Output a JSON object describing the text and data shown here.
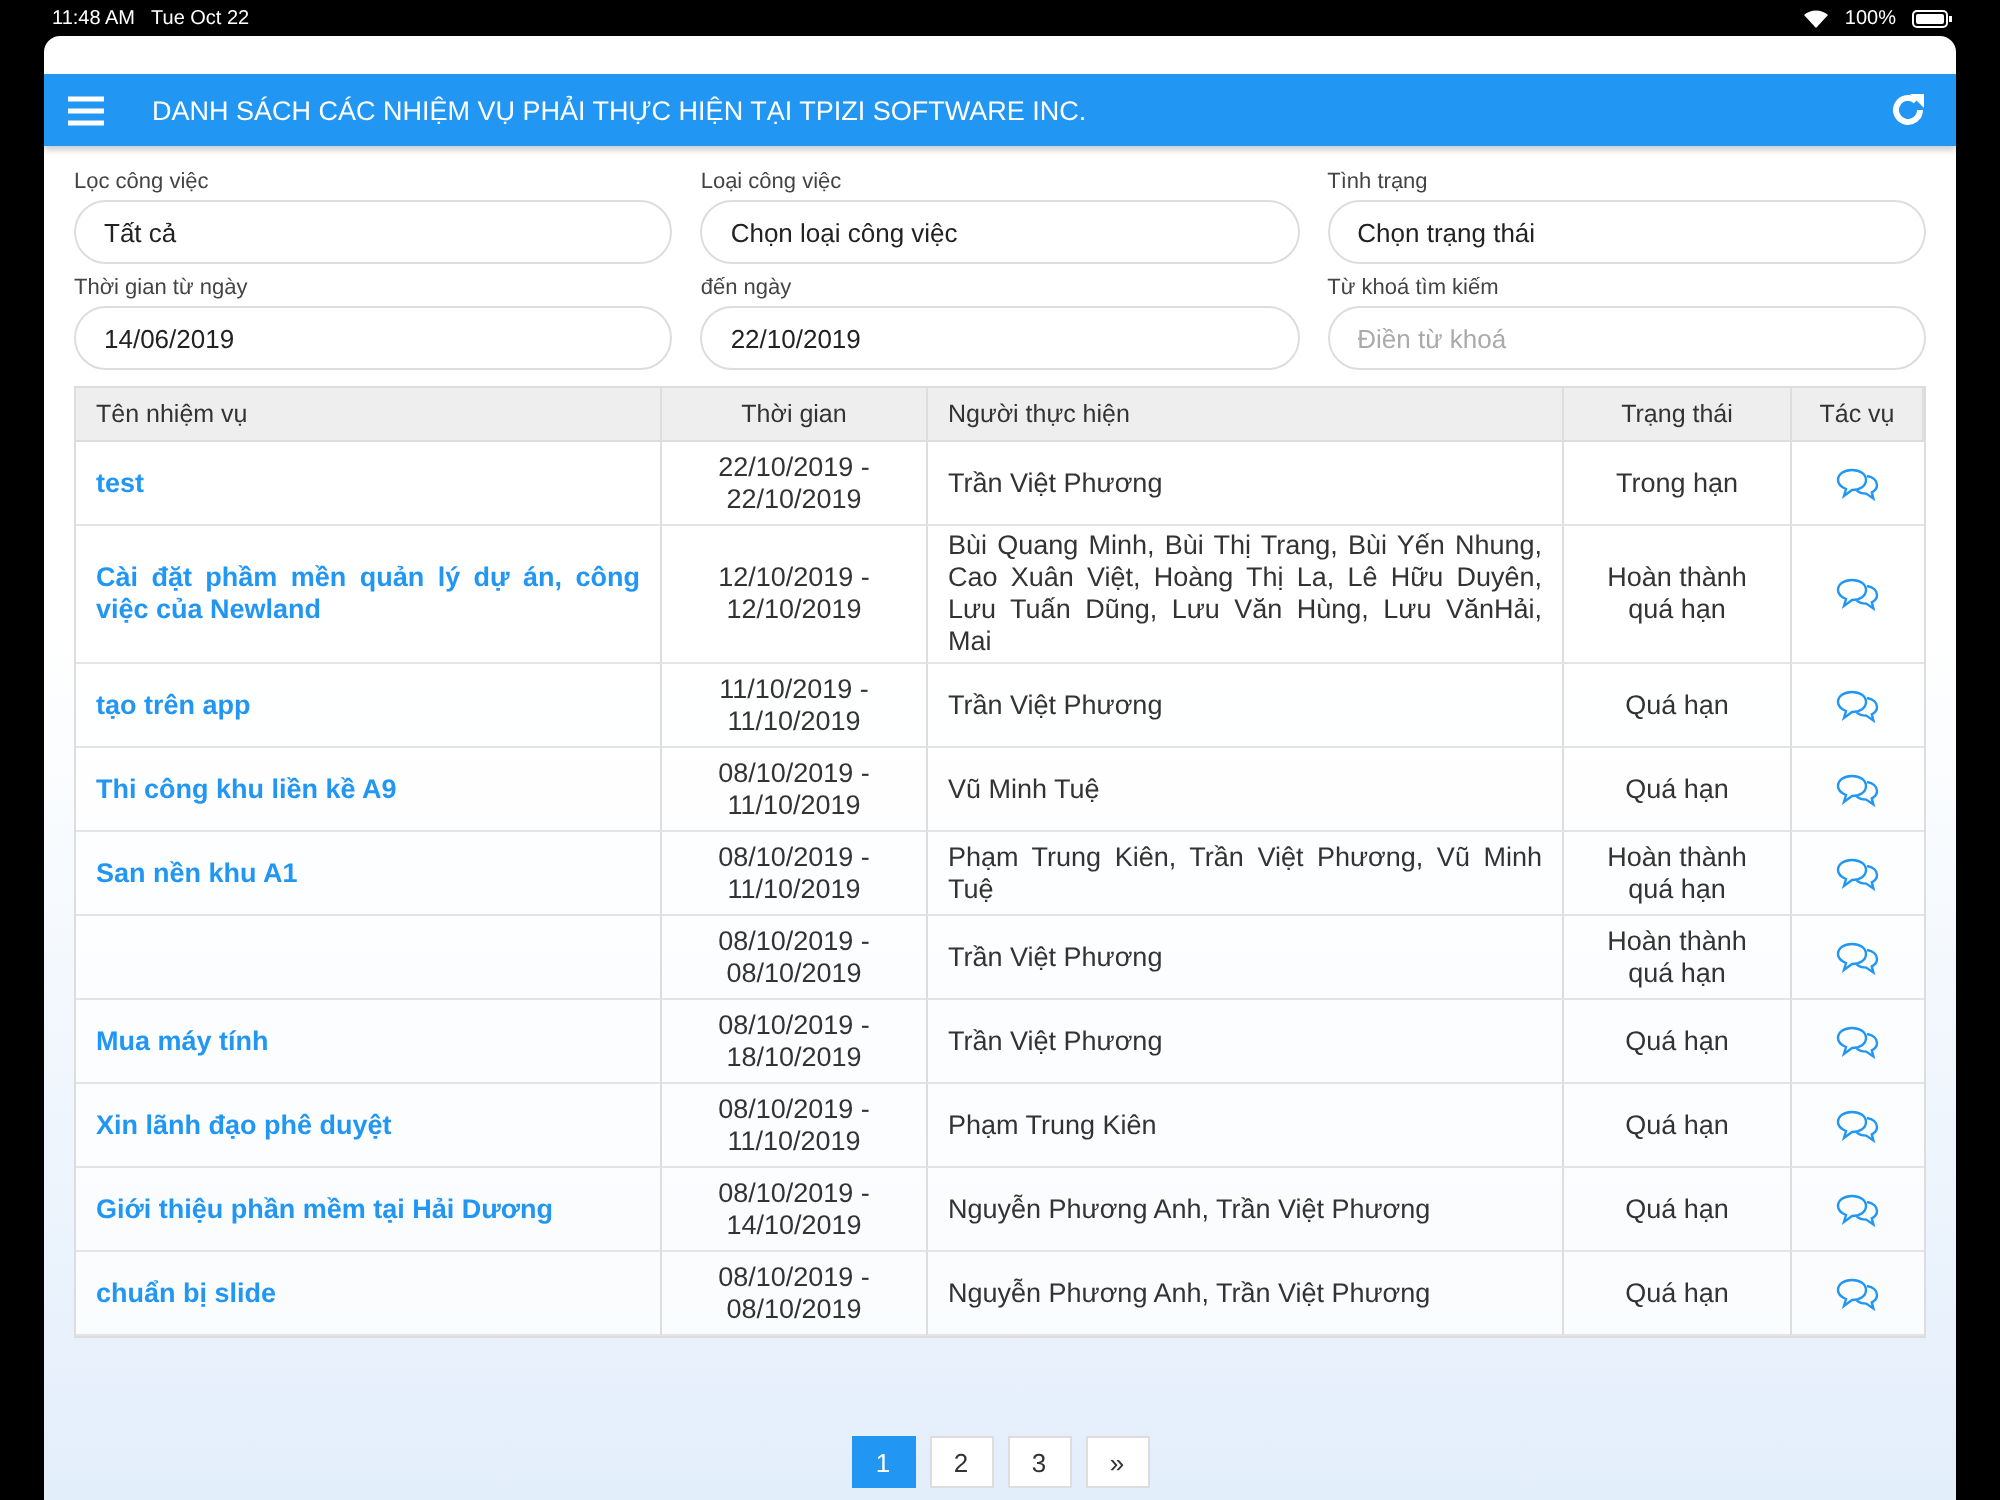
{
  "status_bar": {
    "time": "11:48 AM",
    "date": "Tue Oct 22",
    "battery": "100%"
  },
  "header": {
    "title": "DANH SÁCH CÁC NHIỆM VỤ PHẢI THỰC HIỆN TẠI TPIZI SOFTWARE INC."
  },
  "filters": [
    {
      "label": "Lọc công việc",
      "value": "Tất cả"
    },
    {
      "label": "Loại công việc",
      "value": "Chọn loại công việc"
    },
    {
      "label": "Tình trạng",
      "value": "Chọn trạng thái"
    },
    {
      "label": "Thời gian từ ngày",
      "value": "14/06/2019"
    },
    {
      "label": "đến ngày",
      "value": "22/10/2019"
    },
    {
      "label": "Từ khoá tìm kiếm",
      "placeholder": "Điền từ khoá"
    }
  ],
  "table": {
    "columns": [
      "Tên nhiệm vụ",
      "Thời gian",
      "Người thực hiện",
      "Trạng thái",
      "Tác vụ"
    ],
    "rows": [
      {
        "name": "test",
        "time": "22/10/2019 - 22/10/2019",
        "assignees": "Trần Việt Phương",
        "status": "Trong hạn"
      },
      {
        "name": "Cài đặt phầm mền quản lý dự án, công việc của Newland",
        "time": "12/10/2019 - 12/10/2019",
        "assignees": "Bùi Quang Minh, Bùi Thị Trang, Bùi Yến Nhung, Cao Xuân Việt, Hoàng Thị La, Lê Hữu Duyên, Lưu Tuấn Dũng, Lưu Văn Hùng, Lưu VănHải, Mai",
        "status": "Hoàn thành quá hạn"
      },
      {
        "name": "tạo trên app",
        "time": "11/10/2019 - 11/10/2019",
        "assignees": "Trần Việt Phương",
        "status": "Quá hạn"
      },
      {
        "name": "Thi công khu liền kề A9",
        "time": "08/10/2019 - 11/10/2019",
        "assignees": "Vũ Minh Tuệ",
        "status": "Quá hạn"
      },
      {
        "name": "San nền khu A1",
        "time": "08/10/2019 - 11/10/2019",
        "assignees": "Phạm Trung Kiên, Trần Việt Phương, Vũ Minh Tuệ",
        "status": "Hoàn thành quá hạn"
      },
      {
        "time": "08/10/2019 - 08/10/2019",
        "assignees": "Trần Việt Phương",
        "status": "Hoàn thành quá hạn"
      },
      {
        "name": "Mua máy tính",
        "time": "08/10/2019 - 18/10/2019",
        "assignees": "Trần Việt Phương",
        "status": "Quá hạn"
      },
      {
        "name": "Xin lãnh đạo phê duyệt",
        "time": "08/10/2019 - 11/10/2019",
        "assignees": "Phạm Trung Kiên",
        "status": "Quá hạn"
      },
      {
        "name": "Giới thiệu phần mềm tại Hải Dương",
        "time": "08/10/2019 - 14/10/2019",
        "assignees": "Nguyễn Phương Anh, Trần Việt Phương",
        "status": "Quá hạn"
      },
      {
        "name": "chuẩn bị slide",
        "time": "08/10/2019 - 08/10/2019",
        "assignees": "Nguyễn Phương Anh, Trần Việt Phương",
        "status": "Quá hạn"
      }
    ]
  },
  "pagination": [
    {
      "label": "1",
      "selected": true
    },
    {
      "label": "2",
      "selected": false
    },
    {
      "label": "3",
      "selected": false
    },
    {
      "label": "»",
      "selected": false
    }
  ]
}
